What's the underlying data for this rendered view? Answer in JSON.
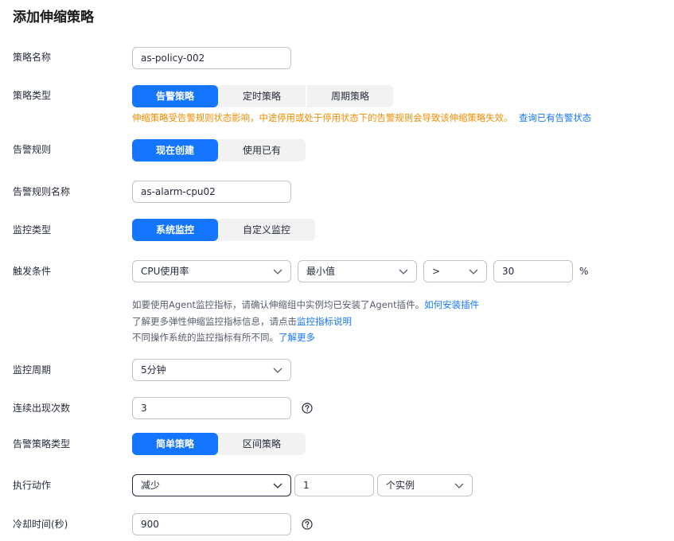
{
  "page": {
    "title": "添加伸缩策略"
  },
  "fields": {
    "policy_name": {
      "label": "策略名称",
      "value": "as-policy-002"
    },
    "policy_type": {
      "label": "策略类型",
      "options": [
        "告警策略",
        "定时策略",
        "周期策略"
      ],
      "selected": "告警策略",
      "warning": "伸缩策略受告警规则状态影响，中途停用或处于停用状态下的告警规则会导致该伸缩策略失效。",
      "warning_link": "查询已有告警状态"
    },
    "alarm_rule": {
      "label": "告警规则",
      "options": [
        "现在创建",
        "使用已有"
      ],
      "selected": "现在创建"
    },
    "alarm_rule_name": {
      "label": "告警规则名称",
      "value": "as-alarm-cpu02"
    },
    "monitor_type": {
      "label": "监控类型",
      "options": [
        "系统监控",
        "自定义监控"
      ],
      "selected": "系统监控"
    },
    "trigger": {
      "label": "触发条件",
      "metric": "CPU使用率",
      "aggregation": "最小值",
      "operator": ">",
      "threshold": "30",
      "unit": "%",
      "hint1_text": "如要使用Agent监控指标，请确认伸缩组中实例均已安装了Agent插件。",
      "hint1_link": "如何安装插件",
      "hint2_text": "了解更多弹性伸缩监控指标信息，请点击",
      "hint2_link": "监控指标说明",
      "hint3_text": "不同操作系统的监控指标有所不同。",
      "hint3_link": "了解更多"
    },
    "monitor_period": {
      "label": "监控周期",
      "value": "5分钟"
    },
    "consecutive": {
      "label": "连续出现次数",
      "value": "3"
    },
    "alarm_policy_type": {
      "label": "告警策略类型",
      "options": [
        "简单策略",
        "区间策略"
      ],
      "selected": "简单策略"
    },
    "action": {
      "label": "执行动作",
      "operation": "减少",
      "count": "1",
      "unit": "个实例"
    },
    "cooldown": {
      "label": "冷却时间(秒)",
      "value": "900"
    }
  },
  "colors": {
    "primary": "#1476ff",
    "warning": "#f28c00",
    "segment_bg": "#f2f2f2"
  },
  "icons": {
    "dropdown": "chevron-down-icon",
    "help": "question-circle-icon"
  }
}
